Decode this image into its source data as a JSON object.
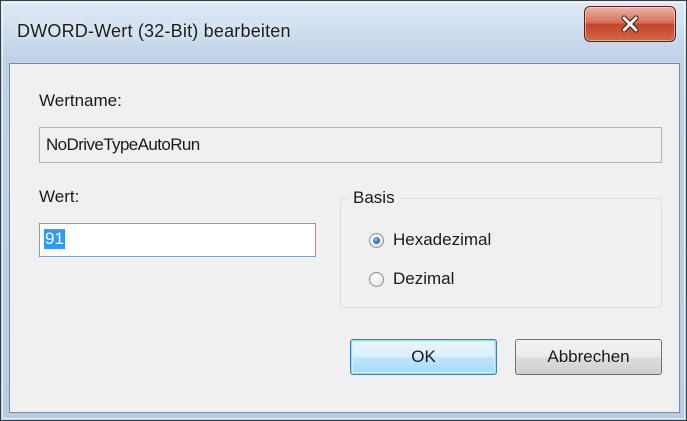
{
  "window": {
    "title": "DWORD-Wert (32-Bit) bearbeiten",
    "close_icon": "close-x-icon"
  },
  "form": {
    "name_label": "Wertname:",
    "name_value": "NoDriveTypeAutoRun",
    "value_label": "Wert:",
    "value_input": "91",
    "base_group": {
      "title": "Basis",
      "options": [
        {
          "label": "Hexadezimal",
          "checked": true
        },
        {
          "label": "Dezimal",
          "checked": false
        }
      ]
    }
  },
  "buttons": {
    "ok_label": "OK",
    "cancel_label": "Abbrechen"
  },
  "colors": {
    "selection": "#3399ff",
    "close_red": "#c4452b",
    "default_button": "#3c7fb1"
  }
}
